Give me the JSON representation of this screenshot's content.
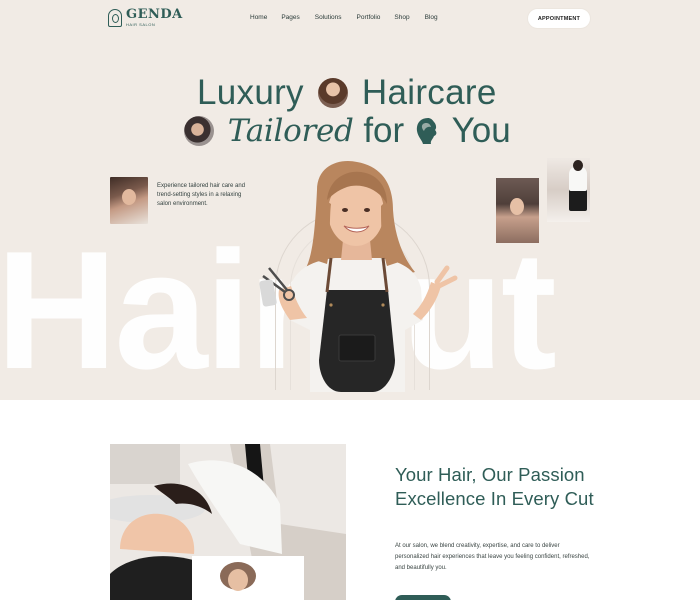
{
  "brand": {
    "name": "GENDA",
    "tagline": "HAIR SALON"
  },
  "nav": {
    "items": [
      "Home",
      "Pages",
      "Solutions",
      "Portfolio",
      "Shop",
      "Blog"
    ]
  },
  "header": {
    "cta_label": "APPOINTMENT"
  },
  "hero": {
    "line1_a": "Luxury",
    "line1_b": "Haircare",
    "line2_italic": "Tailored",
    "line2_b": "for",
    "line2_c": "You",
    "intro_text": "Experience tailored hair care and trend-setting styles in a relaxing salon environment.",
    "background_word": "Haircut"
  },
  "about": {
    "title": "Your Hair, Our Passion Excellence In Every Cut",
    "text": "At our salon, we blend creativity, expertise, and care to deliver personalized hair experiences that leave you feeling confident, refreshed, and beautifully you."
  },
  "colors": {
    "accent": "#2f5d57",
    "hero_bg": "#f1ebe5",
    "text": "#33413f"
  }
}
